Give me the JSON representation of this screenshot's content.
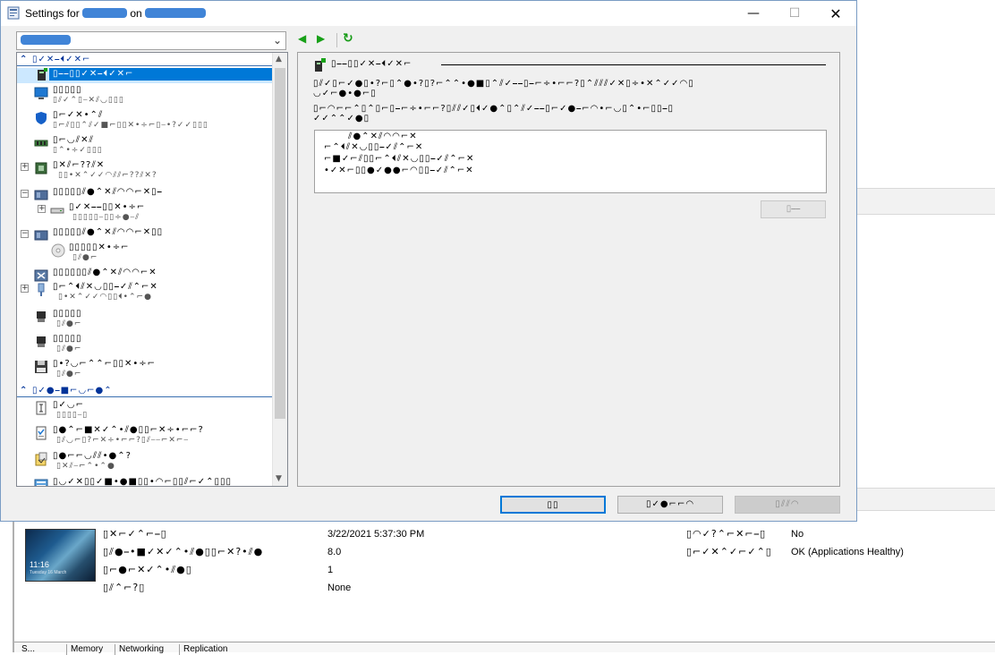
{
  "dialog": {
    "title_prefix": "Settings for ",
    "title_middle": " on ",
    "tb_min": "—",
    "tb_max": "☐",
    "tb_close": "✕"
  },
  "toolbar": {
    "prev": "◀",
    "next": "▶",
    "refresh": "↻",
    "select_chev": "⌄"
  },
  "tree": {
    "hardware_header": "▯✓✕⎯⏴✓✕⌐",
    "management_header": "▯✓●⎯■⌐◡⌐●⌃",
    "items": [
      {
        "t1": "▯⎯⎯▯▯✓✕⎯⏴✓✕⌐",
        "t2": ""
      },
      {
        "t1": "▯▯▯▯▯",
        "t2": "▯⫽✓⌃▯⎯✕⫽◡▯▯▯"
      },
      {
        "t1": "▯⌐✓✕•⌃⫽",
        "t2": "▯⌐⫽▯▯⌃⫽✓■⌐▯▯✕•÷⌐▯⎯•?✓✓▯▯▯"
      },
      {
        "t1": "▯⌐◡⫽✕⫽",
        "t2": "▯⌃•÷✓▯▯▯"
      },
      {
        "t1": "▯✕⫽⌐??⫽✕",
        "t2": "▯▯•✕⌃✓✓◠⫽⫽⌐??⫽✕?"
      },
      {
        "t1": "▯▯▯▯▯⫽●⌃✕⫽◠◠⌐✕▯⎯",
        "t2": ""
      },
      {
        "t1": "▯✓✕⎯⎯▯▯✕•÷⌐",
        "t2": "▯▯▯▯▯⎯▯▯÷●⎯⫽"
      },
      {
        "t1": "▯▯▯▯▯⫽●⌃✕⫽◠◠⌐✕▯▯",
        "t2": ""
      },
      {
        "t1": "▯▯▯▯▯✕•÷⌐",
        "t2": "▯⫽●⌐"
      },
      {
        "t1": "▯▯▯▯▯▯⫽●⌃✕⫽◠◠⌐✕",
        "t2": ""
      },
      {
        "t1": "▯⌐⌃⏴⫽✕◡▯▯⎯✓⫽⌃⌐✕",
        "t2": "▯•✕⌃✓✓◠▯▯⏴•⌃⌐●"
      },
      {
        "t1": "▯▯▯▯▯",
        "t2": "▯⫽●⌐"
      },
      {
        "t1": "▯▯▯▯▯",
        "t2": "▯⫽●⌐"
      },
      {
        "t1": "▯•?◡⌐⌃⌃⌐▯▯✕•÷⌐",
        "t2": "▯⫽●⌐"
      },
      {
        "t1": "▯✓◡⌐",
        "t2": "▯▯▯▯⎯▯"
      },
      {
        "t1": "▯●⌃⌐■✕✓⌃•⫽●▯▯⌐✕÷•⌐⌐?",
        "t2": "▯⫽◡⌐▯?⌐✕÷•⌐⌐?▯⫽⎯⎯⌐✕⌐⎯"
      },
      {
        "t1": "▯●⌐⌐◡⫽⫽•●⌃?",
        "t2": "▯✕⫽⎯⌐⌃•⌃●"
      },
      {
        "t1": "▯◡✓✕▯▯✓■•●■▯▯•◠⌐▯▯⫽⌐✓⌃▯▯▯",
        "t2": ""
      }
    ]
  },
  "panel": {
    "title": "▯⎯⎯▯▯✓✕⎯⏴✓✕⌐",
    "para1_l1": "▯⫽✓▯⌐✓●▯•?⌐▯⌃●•?▯?⌐⌃⌃•●■▯⌃⫽✓⎯⎯▯⎯⌐÷•⌐⌐?▯⌃⫽⫽⫽✓✕▯÷•✕⌃✓✓◠▯",
    "para1_l2": "◡✓⌐●•●⌐▯",
    "para2_l1": "▯⌐◠⌐⌐⌃▯⌃▯⌐▯⎯⌐÷•⌐⌐?▯⫽⫽✓▯⏴✓●⌃▯⌃⫽✓⎯⎯▯⌐✓●⎯⌐◠•⌐◡▯⌃•⌐▯▯⎯▯",
    "para2_l2": "✓✓⌃⌃✓●▯",
    "info_l1": "⫽●⌃✕⫽◠◠⌐✕",
    "info_l2": "⌐⌃⏴⫽✕◡▯▯⎯✓⫽⌃⌐✕",
    "info_l3": "⌐■✓⌐⫽▯▯⌐⌃⏴⫽✕◡▯▯⎯✓⫽⌃⌐✕",
    "info_l4": "•✓✕⌐▯▯●✓●●⌐◠▯▯⎯✓⫽⌃⌐✕",
    "action_btn": "▯⎯⎯"
  },
  "footer": {
    "ok": "▯▯",
    "cancel": "▯✓●⌐⌐◠",
    "apply": "▯⫽⫽◠"
  },
  "vm_details": {
    "thumb_clock": "11:16",
    "thumb_sub": "Tuesday 16 March",
    "rows": [
      {
        "label": "▯✕⌐✓⌃⌐⎯▯",
        "value": "3/22/2021 5:37:30 PM"
      },
      {
        "label": "▯⫽●⎯•■✓✕✓⌃•⫽●▯▯⌐✕?•⫽●",
        "value": "8.0"
      },
      {
        "label": "▯⌐●⌐✕✓⌃•⫽●▯",
        "value": "1"
      },
      {
        "label": "▯⫽⌃⌐?▯",
        "value": "None"
      }
    ],
    "rows_right": [
      {
        "label": "▯◠✓?⌃⌐✕⌐⎯▯",
        "value": "No"
      },
      {
        "label": "▯⌐✓✕⌃✓⌐✓⌃▯",
        "value": "OK (Applications Healthy)"
      }
    ]
  },
  "tabs": [
    "S...",
    "Memory",
    "Networking",
    "Replication"
  ]
}
